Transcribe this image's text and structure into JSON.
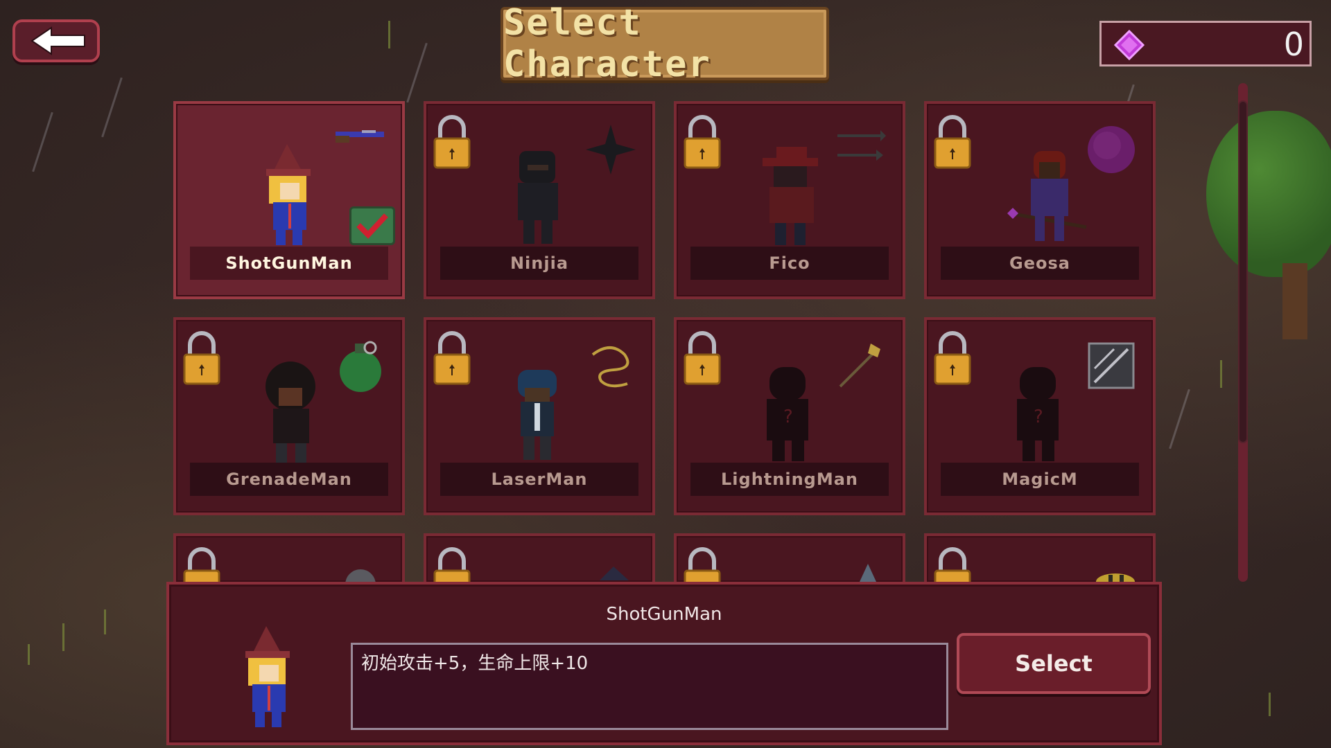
{
  "header": {
    "back_icon": "back-arrow-icon",
    "title": "Select Character",
    "gem_icon": "gem-icon",
    "gem_count": "0"
  },
  "characters": [
    {
      "name": "ShotGunMan",
      "locked": false,
      "selected": true,
      "weapon": "shotgun-icon"
    },
    {
      "name": "Ninjia",
      "locked": true,
      "selected": false,
      "weapon": "shuriken-icon"
    },
    {
      "name": "Fico",
      "locked": true,
      "selected": false,
      "weapon": "arrows-icon"
    },
    {
      "name": "Geosa",
      "locked": true,
      "selected": false,
      "weapon": "purple-orb-icon"
    },
    {
      "name": "GrenadeMan",
      "locked": true,
      "selected": false,
      "weapon": "grenade-icon"
    },
    {
      "name": "LaserMan",
      "locked": true,
      "selected": false,
      "weapon": "laser-coil-icon"
    },
    {
      "name": "LightningMan",
      "locked": true,
      "selected": false,
      "weapon": "lightning-staff-icon"
    },
    {
      "name": "MagicM",
      "locked": true,
      "selected": false,
      "weapon": "magic-frame-icon"
    },
    {
      "name": "",
      "locked": true,
      "selected": false,
      "weapon": "spiked-ball-icon"
    },
    {
      "name": "",
      "locked": true,
      "selected": false,
      "weapon": "bird-icon"
    },
    {
      "name": "",
      "locked": true,
      "selected": false,
      "weapon": "axe-icon"
    },
    {
      "name": "",
      "locked": true,
      "selected": false,
      "weapon": "bee-icon"
    }
  ],
  "detail": {
    "name": "ShotGunMan",
    "description": "初始攻击+5，生命上限+10",
    "select_label": "Select"
  },
  "colors": {
    "card_bg": "#4a1620",
    "card_selected_bg": "#6a2430",
    "accent_gold": "#b08246",
    "gem_purple": "#c23ad8"
  }
}
